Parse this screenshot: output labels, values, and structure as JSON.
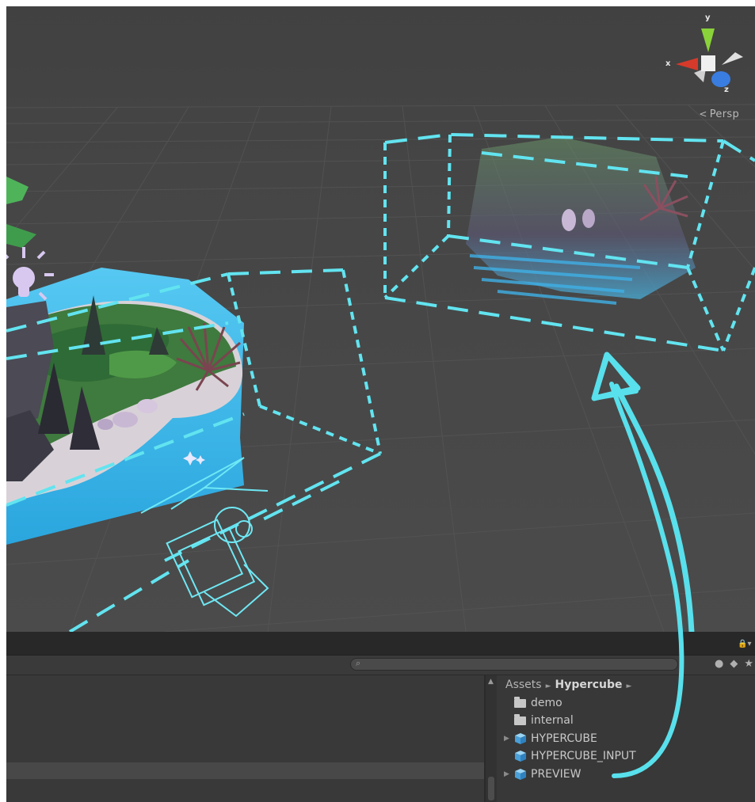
{
  "scene": {
    "projection_label": "Persp",
    "gizmo_axes": {
      "y": "y",
      "x": "x",
      "z": "z"
    },
    "icons": [
      "scene-orientation-gizmo-icon",
      "directional-light-icon",
      "camera-icon",
      "sparkle-icon"
    ],
    "colors": {
      "background": "#474747",
      "accent": "#5ee0ec",
      "gizmo_x": "#d63a2a",
      "gizmo_y": "#8ad23a",
      "gizmo_z": "#3a7de0",
      "water": "#3ab8ea"
    }
  },
  "project": {
    "breadcrumb": {
      "root": "Assets",
      "folder": "Hypercube"
    },
    "assets": [
      {
        "name": "demo",
        "type": "folder",
        "expandable": false
      },
      {
        "name": "internal",
        "type": "folder",
        "expandable": false
      },
      {
        "name": "HYPERCUBE",
        "type": "prefab",
        "expandable": true
      },
      {
        "name": "HYPERCUBE_INPUT",
        "type": "prefab",
        "expandable": false
      },
      {
        "name": "PREVIEW",
        "type": "prefab",
        "expandable": true
      }
    ]
  }
}
